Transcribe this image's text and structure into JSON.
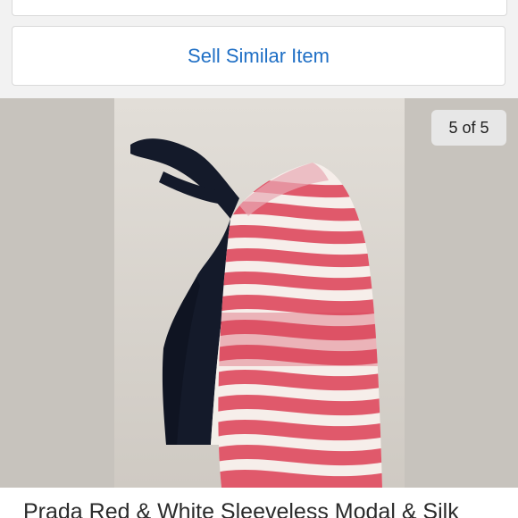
{
  "actions": {
    "sell_similar_label": "Sell Similar Item"
  },
  "gallery": {
    "counter_text": "5 of 5",
    "current_index": 5,
    "total": 5,
    "photo_subject": "red-white-striped-one-shoulder-top-with-black-panel"
  },
  "listing": {
    "title": "Prada Red & White Sleeveless Modal & Silk"
  },
  "colors": {
    "accent_link": "#1f6fc5",
    "gallery_background": "#c7c3bd",
    "card_border": "#d9d9d9"
  }
}
